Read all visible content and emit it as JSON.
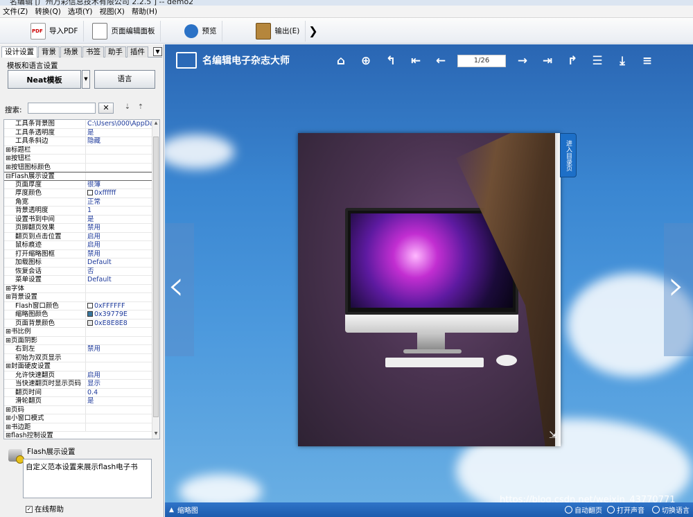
{
  "window": {
    "title": "名编辑 [广州万彩信息技术有限公司 2.2.5 ] -- demo2"
  },
  "menu": [
    "文件(Z)",
    "转换(Q)",
    "选项(Y)",
    "视图(X)",
    "帮助(H)"
  ],
  "toolbar": {
    "import_pdf": "导入PDF",
    "page_editor": "页面编辑面板",
    "preview": "预览",
    "output": "输出(E)",
    "more": "❯"
  },
  "left": {
    "tabs": [
      "设计设置",
      "背景",
      "场景",
      "书签",
      "助手",
      "插件"
    ],
    "template_group_label": "模板和语言设置",
    "template_button": "Neat模板",
    "language_button": "语言",
    "search_label": "搜索:",
    "search_placeholder": "",
    "clear_button": "✕",
    "rows": [
      {
        "k": "工具条背景图",
        "v": "C:\\Users\\000\\AppDat...",
        "kind": "ind"
      },
      {
        "k": "工具条透明度",
        "v": "是",
        "kind": "ind"
      },
      {
        "k": "工具条斜边",
        "v": "隐藏",
        "kind": "ind"
      },
      {
        "k": "⊞标题栏",
        "v": "",
        "kind": "ind2"
      },
      {
        "k": "⊞按钮栏",
        "v": "",
        "kind": "ind2"
      },
      {
        "k": "⊞按钮图标颜色",
        "v": "",
        "kind": "ind2"
      },
      {
        "k": "⊟Flash展示设置",
        "v": "",
        "kind": "head"
      },
      {
        "k": "页面厚度",
        "v": "很薄",
        "kind": "ind"
      },
      {
        "k": "厚度颜色",
        "v": "0xffffff",
        "kind": "ind",
        "swatch": "#ffffff"
      },
      {
        "k": "角宽",
        "v": "正常",
        "kind": "ind"
      },
      {
        "k": "背景透明度",
        "v": "1",
        "kind": "ind"
      },
      {
        "k": "设置书到中间",
        "v": "是",
        "kind": "ind"
      },
      {
        "k": "页脚翻页效果",
        "v": "禁用",
        "kind": "ind"
      },
      {
        "k": "翻页到点击位置",
        "v": "启用",
        "kind": "ind"
      },
      {
        "k": "鼠标痕迹",
        "v": "启用",
        "kind": "ind"
      },
      {
        "k": "打开缩略图框",
        "v": "禁用",
        "kind": "ind"
      },
      {
        "k": "加载图标",
        "v": "Default",
        "kind": "ind"
      },
      {
        "k": "恢复会话",
        "v": "否",
        "kind": "ind"
      },
      {
        "k": "菜单设置",
        "v": "Default",
        "kind": "ind"
      },
      {
        "k": "⊞字体",
        "v": "",
        "kind": "ind2"
      },
      {
        "k": "⊞背景设置",
        "v": "",
        "kind": "ind2"
      },
      {
        "k": "Flash窗口颜色",
        "v": "0xFFFFFF",
        "kind": "ind",
        "swatch": "#ffffff"
      },
      {
        "k": "缩略图颜色",
        "v": "0x39779E",
        "kind": "ind",
        "swatch": "#39779E"
      },
      {
        "k": "页面背景颜色",
        "v": "0xE8E8E8",
        "kind": "ind",
        "swatch": "#E8E8E8"
      },
      {
        "k": "⊞书比例",
        "v": "",
        "kind": "ind2"
      },
      {
        "k": "⊞页面阴影",
        "v": "",
        "kind": "ind2"
      },
      {
        "k": "右到左",
        "v": "禁用",
        "kind": "ind"
      },
      {
        "k": "初始为双页显示",
        "v": "",
        "kind": "ind"
      },
      {
        "k": "⊞封面硬皮设置",
        "v": "",
        "kind": "ind2"
      },
      {
        "k": "允许快速翻页",
        "v": "启用",
        "kind": "ind"
      },
      {
        "k": "当快速翻页时显示页码",
        "v": "显示",
        "kind": "ind"
      },
      {
        "k": "翻页时间",
        "v": "0.4",
        "kind": "ind"
      },
      {
        "k": "滑轮翻页",
        "v": "是",
        "kind": "ind"
      },
      {
        "k": "⊞页码",
        "v": "",
        "kind": "ind2"
      },
      {
        "k": "⊞小窗口模式",
        "v": "",
        "kind": "ind2"
      },
      {
        "k": "⊞书边距",
        "v": "",
        "kind": "ind2"
      },
      {
        "k": "⊞flash控制设置",
        "v": "",
        "kind": "cat"
      }
    ],
    "help": {
      "title": "Flash展示设置",
      "text": "自定义范本设置来展示flash电子书",
      "online_help": "在线帮助"
    }
  },
  "viewer": {
    "logo_text": "名编辑电子杂志大师",
    "page_indicator": "1/26",
    "toc_tab": "进入目录页",
    "bottom": {
      "thumbnails": "缩略图",
      "auto_flip": "自动翻页",
      "sound": "打开声音",
      "language": "切换语言"
    },
    "watermark": "https://blog.csdn.net/weixin_43770771"
  },
  "colors": {
    "accent": "#1d6fc7",
    "viewer_bg": "#3a86d1"
  }
}
